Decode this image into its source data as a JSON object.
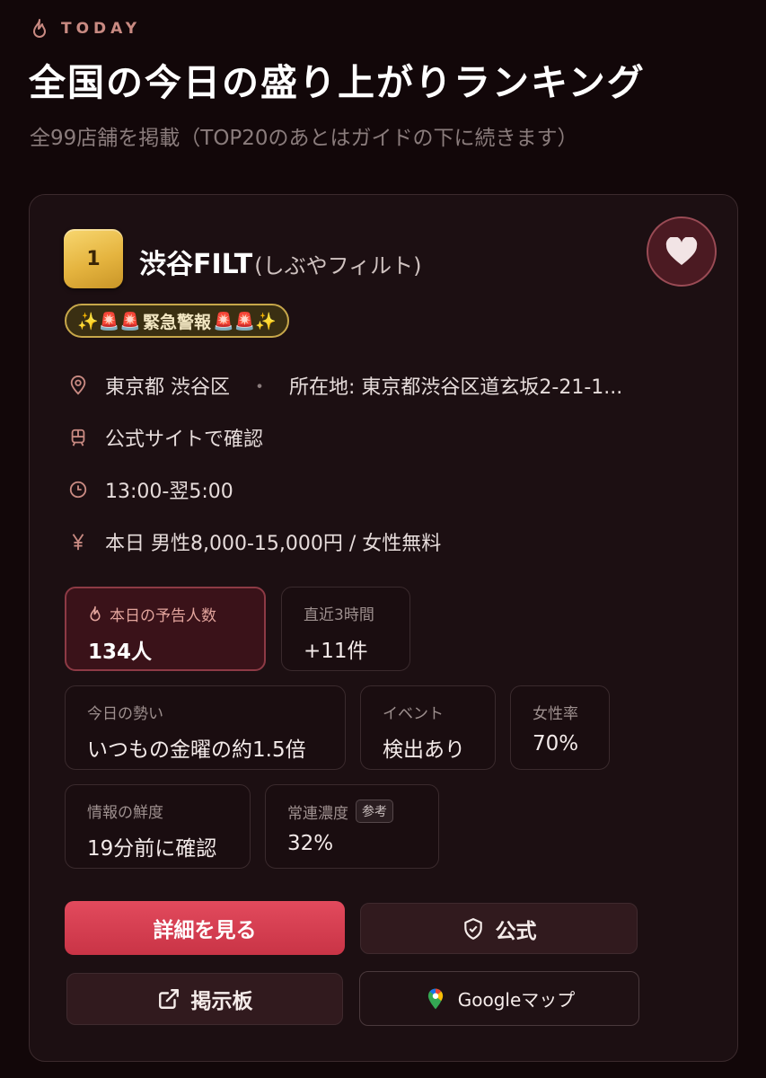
{
  "header": {
    "eyebrow": "TODAY",
    "eyebrow_icon": "flame-icon",
    "title": "全国の今日の盛り上がりランキング",
    "subtitle": "全99店舗を掲載（TOP20のあとはガイドの下に続きます）"
  },
  "card": {
    "rank": "1",
    "name": "渋谷FILT",
    "reading": "(しぶやフィルト)",
    "favorite_icon": "heart-icon",
    "alert": {
      "text": "緊急警報",
      "decor_left": "✨🚨🚨",
      "decor_right": "🚨🚨✨"
    },
    "info": {
      "area": "東京都 渋谷区",
      "separator": "・",
      "address": "所在地: 東京都渋谷区道玄坂2-21-1...",
      "access": "公式サイトで確認",
      "hours": "13:00-翌5:00",
      "price": "本日 男性8,000-15,000円 / 女性無料"
    },
    "stats": {
      "reservations": {
        "label": "本日の予告人数",
        "value": "134人"
      },
      "recent": {
        "label": "直近3時間",
        "value": "+11件"
      },
      "momentum": {
        "label": "今日の勢い",
        "value": "いつもの金曜の約1.5倍"
      },
      "event": {
        "label": "イベント",
        "value": "検出あり"
      },
      "female_ratio": {
        "label": "女性率",
        "value": "70%"
      },
      "freshness": {
        "label": "情報の鮮度",
        "value": "19分前に確認"
      },
      "regulars": {
        "label": "常連濃度",
        "tag": "参考",
        "value": "32%"
      }
    },
    "actions": {
      "details": "詳細を見る",
      "official": "公式",
      "board": "掲示板",
      "google_maps": "Googleマップ"
    },
    "colors": {
      "accent": "#d93c50",
      "gold": "#e5b43f",
      "background": "#120709"
    }
  }
}
